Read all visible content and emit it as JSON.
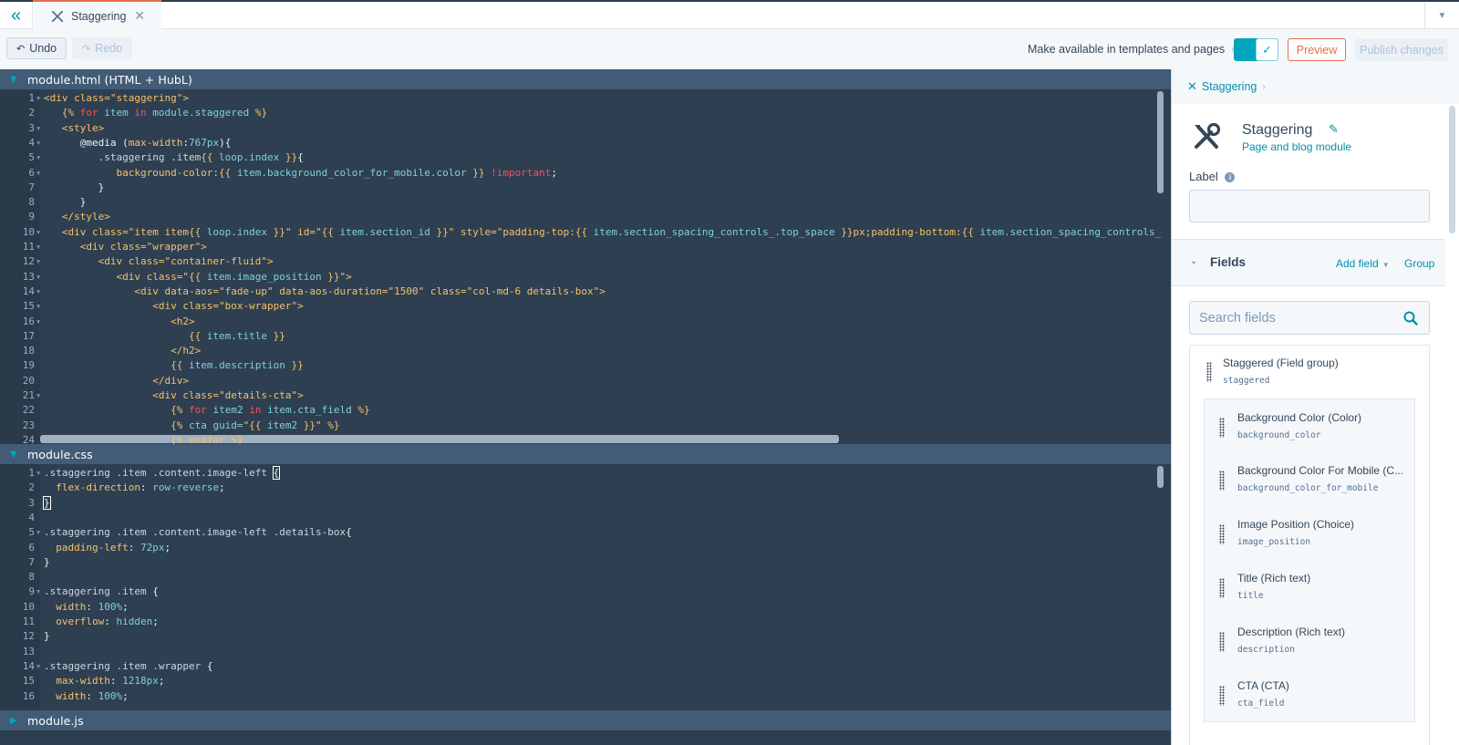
{
  "tabbar": {
    "collapse_icon": "double-chevron-left-icon",
    "tabs": [
      {
        "label": "Staggering",
        "icon": "module-tools-icon",
        "active": true
      }
    ],
    "close_icon": "close-icon",
    "menu_icon": "caret-down-icon"
  },
  "toolbar": {
    "undo_label": "Undo",
    "redo_label": "Redo",
    "availability_label": "Make available in templates and pages",
    "availability_enabled": true,
    "preview_label": "Preview",
    "publish_label": "Publish changes"
  },
  "editors": {
    "html": {
      "title": "module.html (HTML + HubL)",
      "expanded": true,
      "lines": [
        {
          "n": "1",
          "fold": true,
          "segs": [
            [
              "t-tag",
              "<div class=\"staggering\">"
            ]
          ]
        },
        {
          "n": "2",
          "fold": false,
          "segs": [
            [
              "t-tag",
              "   {%"
            ],
            [
              "t-kw",
              " for"
            ],
            [
              "t-var",
              " item"
            ],
            [
              "t-kw",
              " in"
            ],
            [
              "t-var",
              " module.staggered"
            ],
            [
              "t-tag",
              " %}"
            ]
          ]
        },
        {
          "n": "3",
          "fold": true,
          "segs": [
            [
              "t-tag",
              "   <style>"
            ]
          ]
        },
        {
          "n": "4",
          "fold": true,
          "segs": [
            [
              "t-plain",
              "      @media ("
            ],
            [
              "t-tag",
              "max-width"
            ],
            [
              "t-plain",
              ":"
            ],
            [
              "t-var",
              "767px"
            ],
            [
              "t-plain",
              "){"
            ]
          ]
        },
        {
          "n": "5",
          "fold": true,
          "segs": [
            [
              "t-sel",
              "         .staggering .item"
            ],
            [
              "t-tag",
              "{{"
            ],
            [
              "t-var",
              " loop.index"
            ],
            [
              "t-tag",
              " }}"
            ],
            [
              "t-plain",
              "{"
            ]
          ]
        },
        {
          "n": "6",
          "fold": true,
          "segs": [
            [
              "t-tag",
              "            background-color:{{"
            ],
            [
              "t-var",
              " item.background_color_for_mobile.color"
            ],
            [
              "t-tag",
              " }}"
            ],
            [
              "t-imp",
              " !important"
            ],
            [
              "t-plain",
              ";"
            ]
          ]
        },
        {
          "n": "7",
          "fold": false,
          "segs": [
            [
              "t-plain",
              "         }"
            ]
          ]
        },
        {
          "n": "8",
          "fold": false,
          "segs": [
            [
              "t-plain",
              "      }"
            ]
          ]
        },
        {
          "n": "9",
          "fold": false,
          "segs": [
            [
              "t-tag",
              "   </style>"
            ]
          ]
        },
        {
          "n": "10",
          "fold": true,
          "segs": [
            [
              "t-tag",
              "   <div class=\"item item{{"
            ],
            [
              "t-var",
              " loop.index"
            ],
            [
              "t-tag",
              " }}\" id=\"{{"
            ],
            [
              "t-var",
              " item.section_id"
            ],
            [
              "t-tag",
              " }}\" style=\"padding-top:{{"
            ],
            [
              "t-var",
              " item.section_spacing_controls_.top_space"
            ],
            [
              "t-tag",
              " }}px;padding-bottom:{{"
            ],
            [
              "t-var",
              " item.section_spacing_controls_"
            ]
          ]
        },
        {
          "n": "11",
          "fold": true,
          "segs": [
            [
              "t-tag",
              "      <div class=\"wrapper\">"
            ]
          ]
        },
        {
          "n": "12",
          "fold": true,
          "segs": [
            [
              "t-tag",
              "         <div class=\"container-fluid\">"
            ]
          ]
        },
        {
          "n": "13",
          "fold": true,
          "segs": [
            [
              "t-tag",
              "            <div class=\"{{"
            ],
            [
              "t-var",
              " item.image_position"
            ],
            [
              "t-tag",
              " }}\">"
            ]
          ]
        },
        {
          "n": "14",
          "fold": true,
          "segs": [
            [
              "t-tag",
              "               <div data-aos=\"fade-up\" data-aos-duration=\"1500\" class=\"col-md-6 details-box\">"
            ]
          ]
        },
        {
          "n": "15",
          "fold": true,
          "segs": [
            [
              "t-tag",
              "                  <div class=\"box-wrapper\">"
            ]
          ]
        },
        {
          "n": "16",
          "fold": true,
          "segs": [
            [
              "t-tag",
              "                     <h2>"
            ]
          ]
        },
        {
          "n": "17",
          "fold": false,
          "segs": [
            [
              "t-tag",
              "                        {{"
            ],
            [
              "t-var",
              " item.title"
            ],
            [
              "t-tag",
              " }}"
            ]
          ]
        },
        {
          "n": "18",
          "fold": false,
          "segs": [
            [
              "t-tag",
              "                     </h2>"
            ]
          ]
        },
        {
          "n": "19",
          "fold": false,
          "segs": [
            [
              "t-tag",
              "                     {{"
            ],
            [
              "t-var",
              " item.description"
            ],
            [
              "t-tag",
              " }}"
            ]
          ]
        },
        {
          "n": "20",
          "fold": false,
          "segs": [
            [
              "t-tag",
              "                  </div>"
            ]
          ]
        },
        {
          "n": "21",
          "fold": true,
          "segs": [
            [
              "t-tag",
              "                  <div class=\"details-cta\">"
            ]
          ]
        },
        {
          "n": "22",
          "fold": false,
          "segs": [
            [
              "t-tag",
              "                     {%"
            ],
            [
              "t-kw",
              " for"
            ],
            [
              "t-var",
              " item2"
            ],
            [
              "t-kw",
              " in"
            ],
            [
              "t-var",
              " item.cta_field"
            ],
            [
              "t-tag",
              " %}"
            ]
          ]
        },
        {
          "n": "23",
          "fold": false,
          "segs": [
            [
              "t-tag",
              "                     {%"
            ],
            [
              "t-var",
              " cta guid="
            ],
            [
              "t-tag",
              "\"{{"
            ],
            [
              "t-var",
              " item2"
            ],
            [
              "t-tag",
              " }}\" %}"
            ]
          ]
        },
        {
          "n": "24",
          "fold": false,
          "segs": [
            [
              "t-tag",
              "                     {% endfor %}"
            ]
          ]
        }
      ]
    },
    "css": {
      "title": "module.css",
      "expanded": true,
      "lines": [
        {
          "n": "1",
          "fold": true,
          "segs": [
            [
              "t-sel",
              ".staggering .item .content.image-left "
            ],
            [
              "t-plain bracket-hl",
              "{"
            ]
          ]
        },
        {
          "n": "2",
          "fold": false,
          "segs": [
            [
              "t-prop",
              "  flex-direction"
            ],
            [
              "t-plain",
              ": "
            ],
            [
              "t-val",
              "row-reverse"
            ],
            [
              "t-plain",
              ";"
            ]
          ]
        },
        {
          "n": "3",
          "fold": false,
          "segs": [
            [
              "t-plain bracket-hl",
              "}"
            ]
          ]
        },
        {
          "n": "4",
          "fold": false,
          "segs": []
        },
        {
          "n": "5",
          "fold": true,
          "segs": [
            [
              "t-sel",
              ".staggering .item .content.image-left .details-box"
            ],
            [
              "t-plain",
              "{"
            ]
          ]
        },
        {
          "n": "6",
          "fold": false,
          "segs": [
            [
              "t-prop",
              "  padding-left"
            ],
            [
              "t-plain",
              ": "
            ],
            [
              "t-val",
              "72px"
            ],
            [
              "t-plain",
              ";"
            ]
          ]
        },
        {
          "n": "7",
          "fold": false,
          "segs": [
            [
              "t-plain",
              "}"
            ]
          ]
        },
        {
          "n": "8",
          "fold": false,
          "segs": []
        },
        {
          "n": "9",
          "fold": true,
          "segs": [
            [
              "t-sel",
              ".staggering .item "
            ],
            [
              "t-plain",
              "{"
            ]
          ]
        },
        {
          "n": "10",
          "fold": false,
          "segs": [
            [
              "t-prop",
              "  width"
            ],
            [
              "t-plain",
              ": "
            ],
            [
              "t-val",
              "100%"
            ],
            [
              "t-plain",
              ";"
            ]
          ]
        },
        {
          "n": "11",
          "fold": false,
          "segs": [
            [
              "t-prop",
              "  overflow"
            ],
            [
              "t-plain",
              ": "
            ],
            [
              "t-val",
              "hidden"
            ],
            [
              "t-plain",
              ";"
            ]
          ]
        },
        {
          "n": "12",
          "fold": false,
          "segs": [
            [
              "t-plain",
              "}"
            ]
          ]
        },
        {
          "n": "13",
          "fold": false,
          "segs": []
        },
        {
          "n": "14",
          "fold": true,
          "segs": [
            [
              "t-sel",
              ".staggering .item .wrapper "
            ],
            [
              "t-plain",
              "{"
            ]
          ]
        },
        {
          "n": "15",
          "fold": false,
          "segs": [
            [
              "t-prop",
              "  max-width"
            ],
            [
              "t-plain",
              ": "
            ],
            [
              "t-val",
              "1218px"
            ],
            [
              "t-plain",
              ";"
            ]
          ]
        },
        {
          "n": "16",
          "fold": false,
          "segs": [
            [
              "t-prop",
              "  width"
            ],
            [
              "t-plain",
              ": "
            ],
            [
              "t-val",
              "100%"
            ],
            [
              "t-plain",
              ";"
            ]
          ]
        }
      ]
    },
    "js": {
      "title": "module.js",
      "expanded": false
    }
  },
  "sidebar": {
    "breadcrumb": "Staggering",
    "module_name": "Staggering",
    "module_type": "Page and blog module",
    "label_title": "Label",
    "label_value": "",
    "fields_title": "Fields",
    "add_field_label": "Add field",
    "group_label": "Group",
    "search_placeholder": "Search fields",
    "field_group": {
      "name": "Staggered (Field group)",
      "key": "staggered"
    },
    "fields": [
      {
        "name": "Background Color (Color)",
        "key": "background_color"
      },
      {
        "name": "Background Color For Mobile (C...",
        "key": "background_color_for_mobile"
      },
      {
        "name": "Image Position (Choice)",
        "key": "image_position"
      },
      {
        "name": "Title (Rich text)",
        "key": "title"
      },
      {
        "name": "Description (Rich text)",
        "key": "description"
      },
      {
        "name": "CTA (CTA)",
        "key": "cta_field"
      }
    ]
  }
}
